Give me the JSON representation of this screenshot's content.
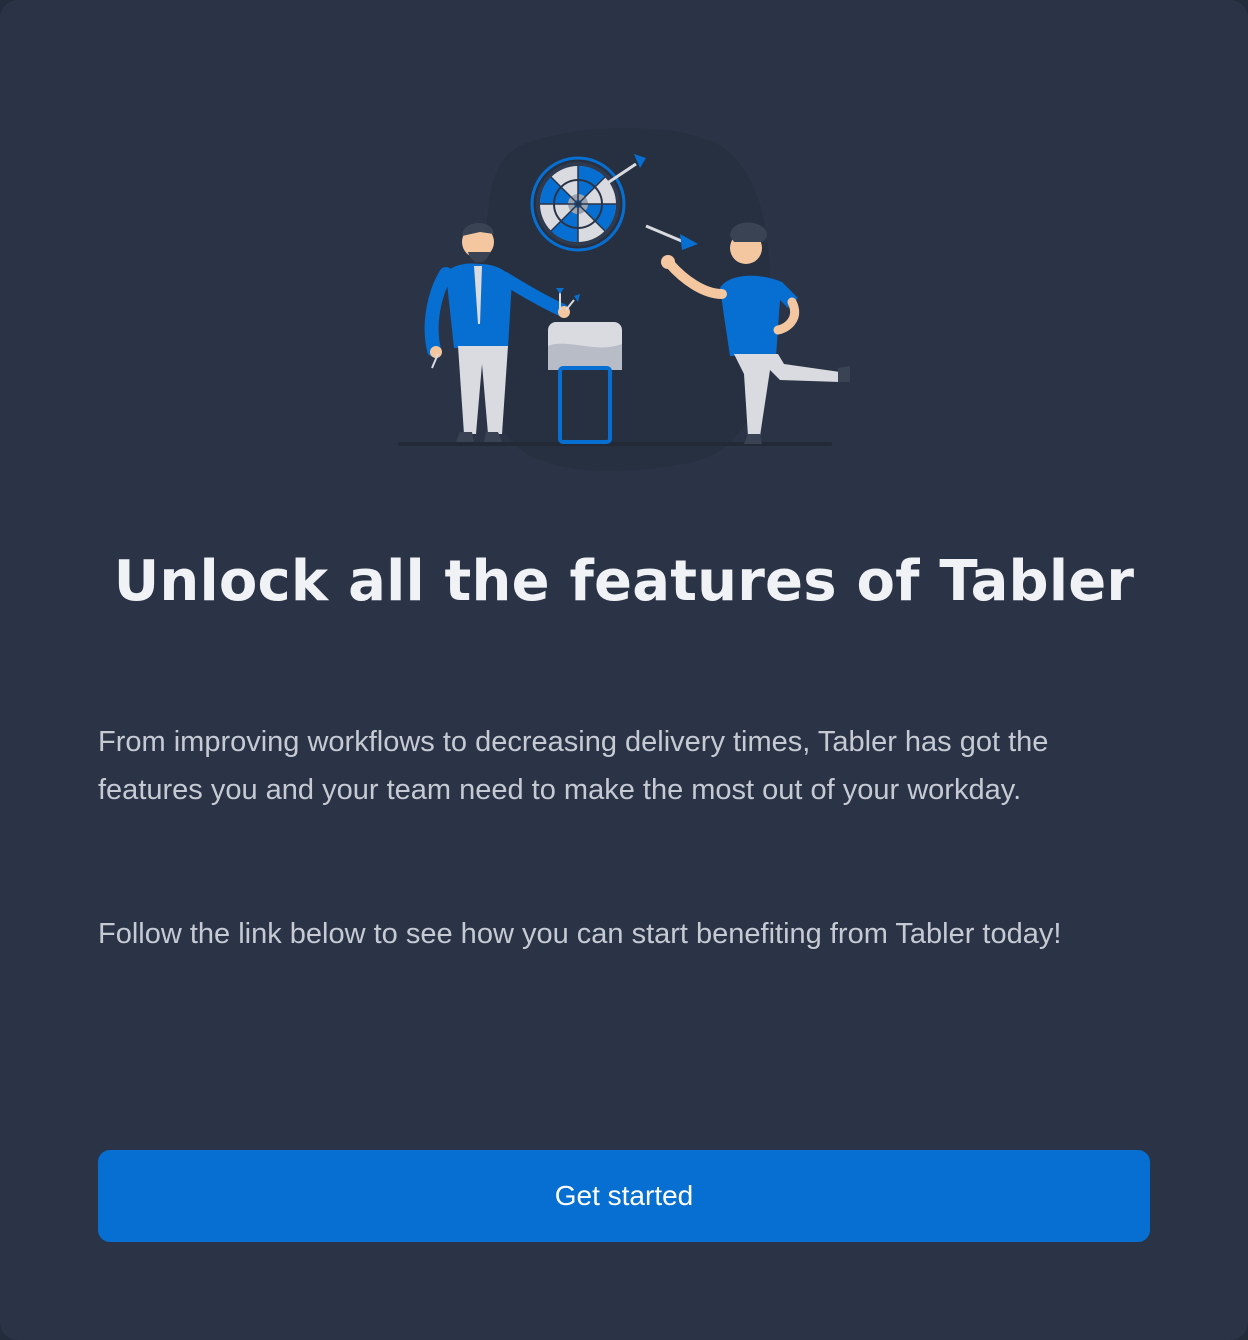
{
  "content": {
    "title": "Unlock all the features of Tabler",
    "paragraph_1": "From improving workflows to decreasing delivery times, Tabler has got the features you and your team need to make the most out of your workday.",
    "paragraph_2": "Follow the link below to see how you can start benefiting from Tabler today!"
  },
  "cta": {
    "label": "Get started"
  },
  "colors": {
    "background": "#2b3447",
    "primary": "#066fd1",
    "title": "#f0f2f5",
    "text": "#c5cad3"
  },
  "illustration": {
    "icon": "darts-team-illustration"
  }
}
